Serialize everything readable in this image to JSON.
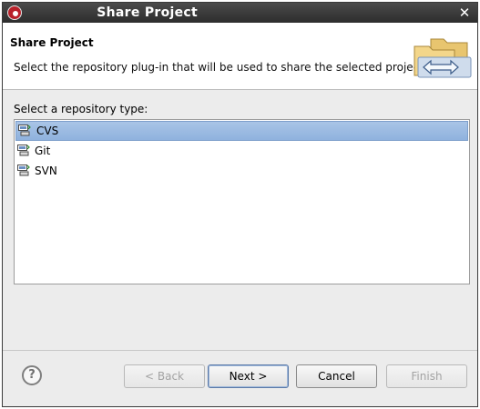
{
  "window": {
    "title": "Share Project",
    "close_glyph": "✕"
  },
  "header": {
    "title": "Share Project",
    "description": "Select the repository plug-in that will be used to share the selected project."
  },
  "main": {
    "list_label": "Select a repository type:",
    "items": [
      {
        "label": "CVS",
        "icon": "cvs-repository-icon",
        "selected": true
      },
      {
        "label": "Git",
        "icon": "git-repository-icon",
        "selected": false
      },
      {
        "label": "SVN",
        "icon": "svn-repository-icon",
        "selected": false
      }
    ]
  },
  "footer": {
    "help_glyph": "?",
    "back_label": "< Back",
    "next_label": "Next >",
    "cancel_label": "Cancel",
    "finish_label": "Finish"
  },
  "colors": {
    "titlebar": "#2d2d2d",
    "selection": "#8fb2de",
    "dialog_bg": "#ececec"
  }
}
